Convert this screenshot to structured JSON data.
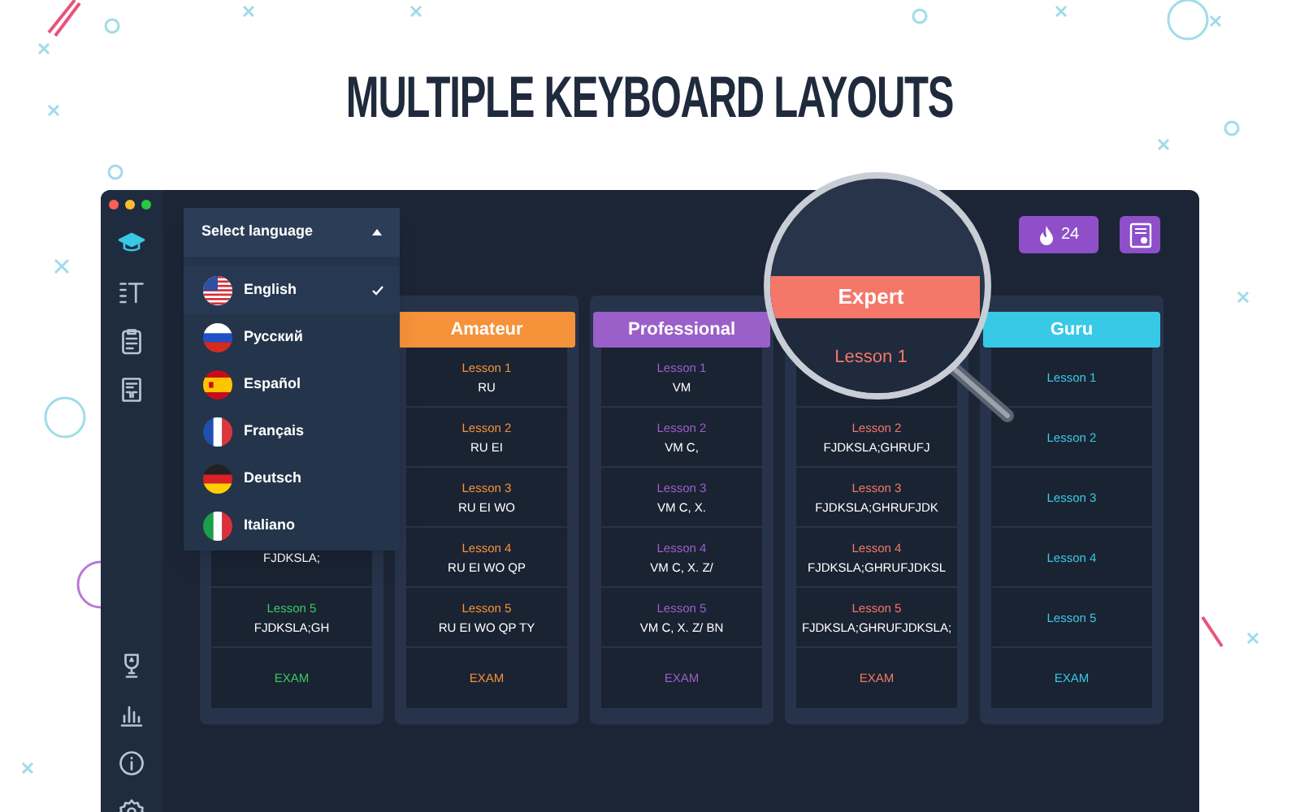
{
  "headline": "MULTIPLE KEYBOARD LAYOUTS",
  "sidebar": {
    "top": [
      {
        "kind": "cap",
        "selected": true
      },
      {
        "kind": "list",
        "selected": false
      },
      {
        "kind": "clipboard",
        "selected": false
      },
      {
        "kind": "doc",
        "selected": false
      }
    ],
    "bottom": [
      {
        "kind": "trophy",
        "selected": false
      },
      {
        "kind": "chart",
        "selected": false
      },
      {
        "kind": "info",
        "selected": false
      },
      {
        "kind": "gear",
        "selected": false
      }
    ]
  },
  "streak_badge": {
    "count": "24"
  },
  "language_menu": {
    "title": "Select language",
    "items": [
      {
        "kind": "us",
        "label": "English",
        "selected": true
      },
      {
        "kind": "ru",
        "label": "Русский",
        "selected": false
      },
      {
        "kind": "es",
        "label": "Español",
        "selected": false
      },
      {
        "kind": "fr",
        "label": "Français",
        "selected": false
      },
      {
        "kind": "de",
        "label": "Deutsch",
        "selected": false
      },
      {
        "kind": "it",
        "label": "Italiano",
        "selected": false
      }
    ]
  },
  "levels": [
    {
      "color": "#3cc864",
      "magnified": false,
      "lessons": [
        {
          "keys": "FJDKSLA;"
        },
        {
          "label": "Lesson 5",
          "keys": "FJDKSLA;GH"
        }
      ],
      "exam": "EXAM"
    },
    {
      "title": "Amateur",
      "color": "#f5923a",
      "magnified": false,
      "lessons": [
        {
          "label": "Lesson 1",
          "keys": "RU"
        },
        {
          "label": "Lesson 2",
          "keys": "RU EI"
        },
        {
          "label": "Lesson 3",
          "keys": "RU EI WO"
        },
        {
          "label": "Lesson 4",
          "keys": "RU EI WO QP"
        },
        {
          "label": "Lesson 5",
          "keys": "RU EI WO QP TY"
        }
      ],
      "exam": "EXAM"
    },
    {
      "title": "Professional",
      "color": "#9b5fc9",
      "magnified": false,
      "lessons": [
        {
          "label": "Lesson 1",
          "keys": "VM"
        },
        {
          "label": "Lesson 2",
          "keys": "VM C,"
        },
        {
          "label": "Lesson 3",
          "keys": "VM C, X."
        },
        {
          "label": "Lesson 4",
          "keys": "VM C, X. Z/"
        },
        {
          "label": "Lesson 5",
          "keys": "VM C, X. Z/ BN"
        }
      ],
      "exam": "EXAM"
    },
    {
      "title": "Expert",
      "color": "#f4776a",
      "magnified": true,
      "lessons": [
        {
          "label": "Lesson 1"
        },
        {
          "label": "Lesson 2",
          "keys": "FJDKSLA;GHRUFJ"
        },
        {
          "label": "Lesson 3",
          "keys": "FJDKSLA;GHRUFJDK"
        },
        {
          "label": "Lesson 4",
          "keys": "FJDKSLA;GHRUFJDKSL"
        },
        {
          "label": "Lesson 5",
          "keys": "FJDKSLA;GHRUFJDKSLA;"
        }
      ],
      "exam": "EXAM"
    },
    {
      "title": "Guru",
      "color": "#38c9e6",
      "magnified": false,
      "lessons": [
        {
          "label": "Lesson 1"
        },
        {
          "label": "Lesson 2"
        },
        {
          "label": "Lesson 3"
        },
        {
          "label": "Lesson 4"
        },
        {
          "label": "Lesson 5"
        }
      ],
      "exam": "EXAM"
    }
  ]
}
